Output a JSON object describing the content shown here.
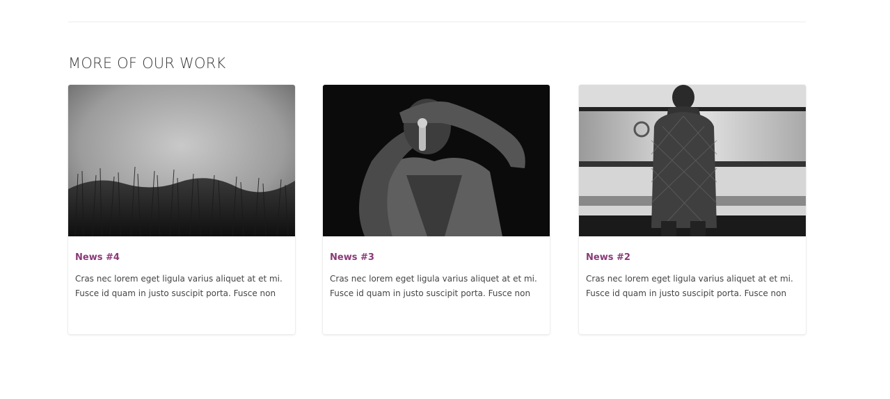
{
  "section": {
    "title": "MORE OF OUR WORK"
  },
  "cards": [
    {
      "title": "News #4",
      "excerpt": "Cras nec lorem eget ligula varius aliquet at et mi. Fusce id quam in justo suscipit porta. Fusce non",
      "image": "grass-field-photo"
    },
    {
      "title": "News #3",
      "excerpt": "Cras nec lorem eget ligula varius aliquet at et mi. Fusce id quam in justo suscipit porta. Fusce non",
      "image": "singer-photo"
    },
    {
      "title": "News #2",
      "excerpt": "Cras nec lorem eget ligula varius aliquet at et mi. Fusce id quam in justo suscipit porta. Fusce non",
      "image": "subway-commuter-photo"
    }
  ],
  "colors": {
    "accent": "#8a3a78",
    "text": "#444444",
    "heading": "#3a3a3a"
  }
}
